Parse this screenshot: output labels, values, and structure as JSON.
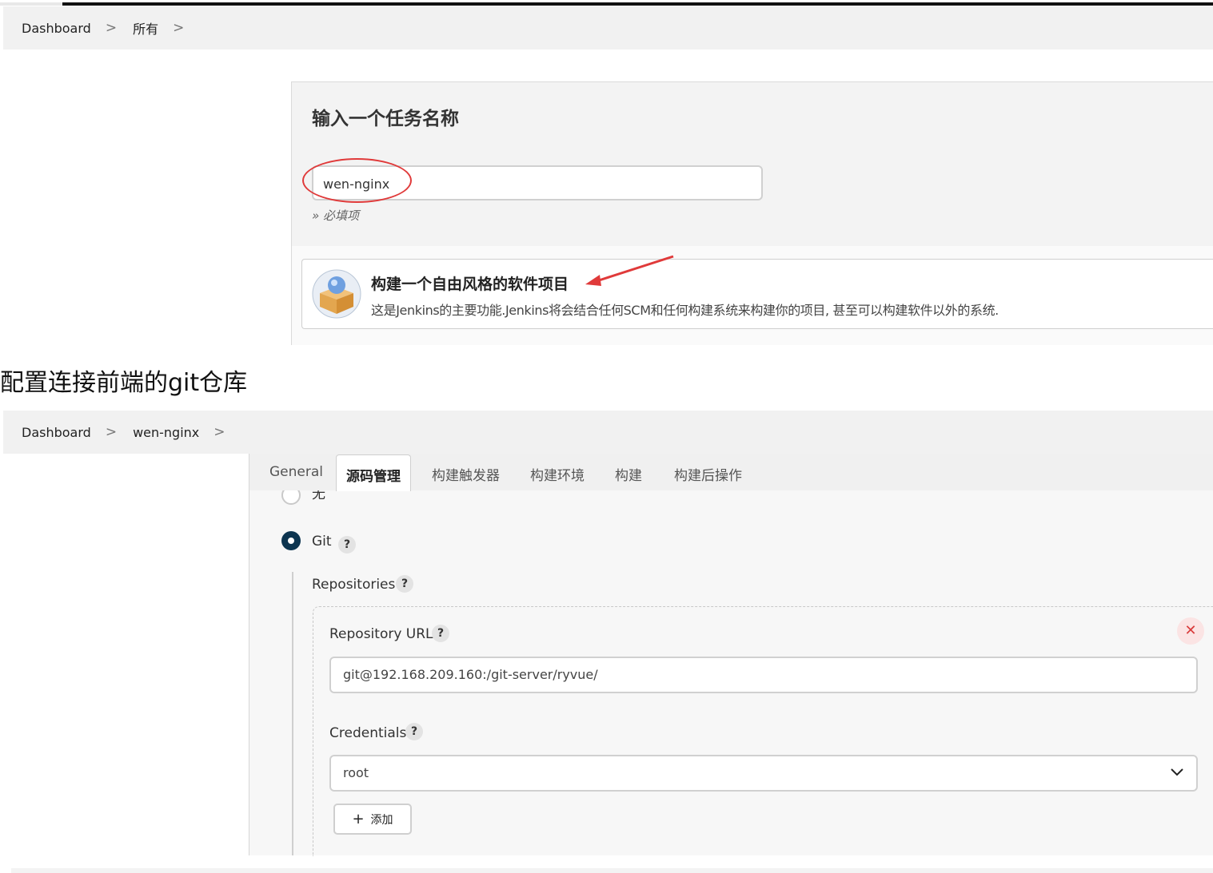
{
  "top": {
    "breadcrumb": [
      "Dashboard",
      "所有"
    ],
    "title": "输入一个任务名称",
    "job_name": "wen-nginx",
    "required_hint": "» 必填项",
    "project_type": {
      "title": "构建一个自由风格的软件项目",
      "description": "这是Jenkins的主要功能.Jenkins将会结合任何SCM和任何构建系统来构建你的项目, 甚至可以构建软件以外的系统."
    }
  },
  "caption": "配置连接前端的git仓库",
  "bottom": {
    "breadcrumb": [
      "Dashboard",
      "wen-nginx"
    ],
    "tabs": [
      "General",
      "源码管理",
      "构建触发器",
      "构建环境",
      "构建",
      "构建后操作"
    ],
    "active_tab": "源码管理",
    "scm_none_label": "无",
    "scm_git_label": "Git",
    "repositories_label": "Repositories",
    "repo_url_label": "Repository URL",
    "repo_url_value": "git@192.168.209.160:/git-server/ryvue/",
    "credentials_label": "Credentials",
    "credentials_value": "root",
    "add_button_label": "添加",
    "help_glyph": "?",
    "close_glyph": "✕"
  },
  "colors": {
    "accent_radio": "#0d3550",
    "annotation_red": "#e03a3a"
  }
}
